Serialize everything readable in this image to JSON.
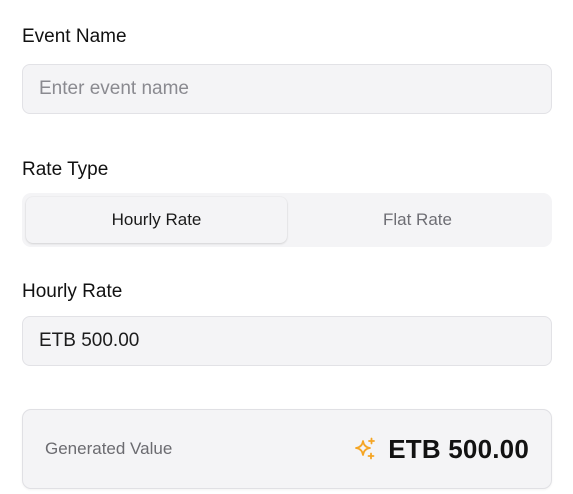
{
  "event_name": {
    "label": "Event Name",
    "value": "",
    "placeholder": "Enter event name"
  },
  "rate_type": {
    "label": "Rate Type",
    "options": [
      {
        "label": "Hourly Rate",
        "selected": true
      },
      {
        "label": "Flat Rate",
        "selected": false
      }
    ]
  },
  "hourly_rate": {
    "label": "Hourly Rate",
    "value": "ETB 500.00"
  },
  "generated": {
    "label": "Generated Value",
    "value": "ETB 500.00",
    "icon": "sparkle-icon",
    "icon_color": "#f5a524"
  }
}
